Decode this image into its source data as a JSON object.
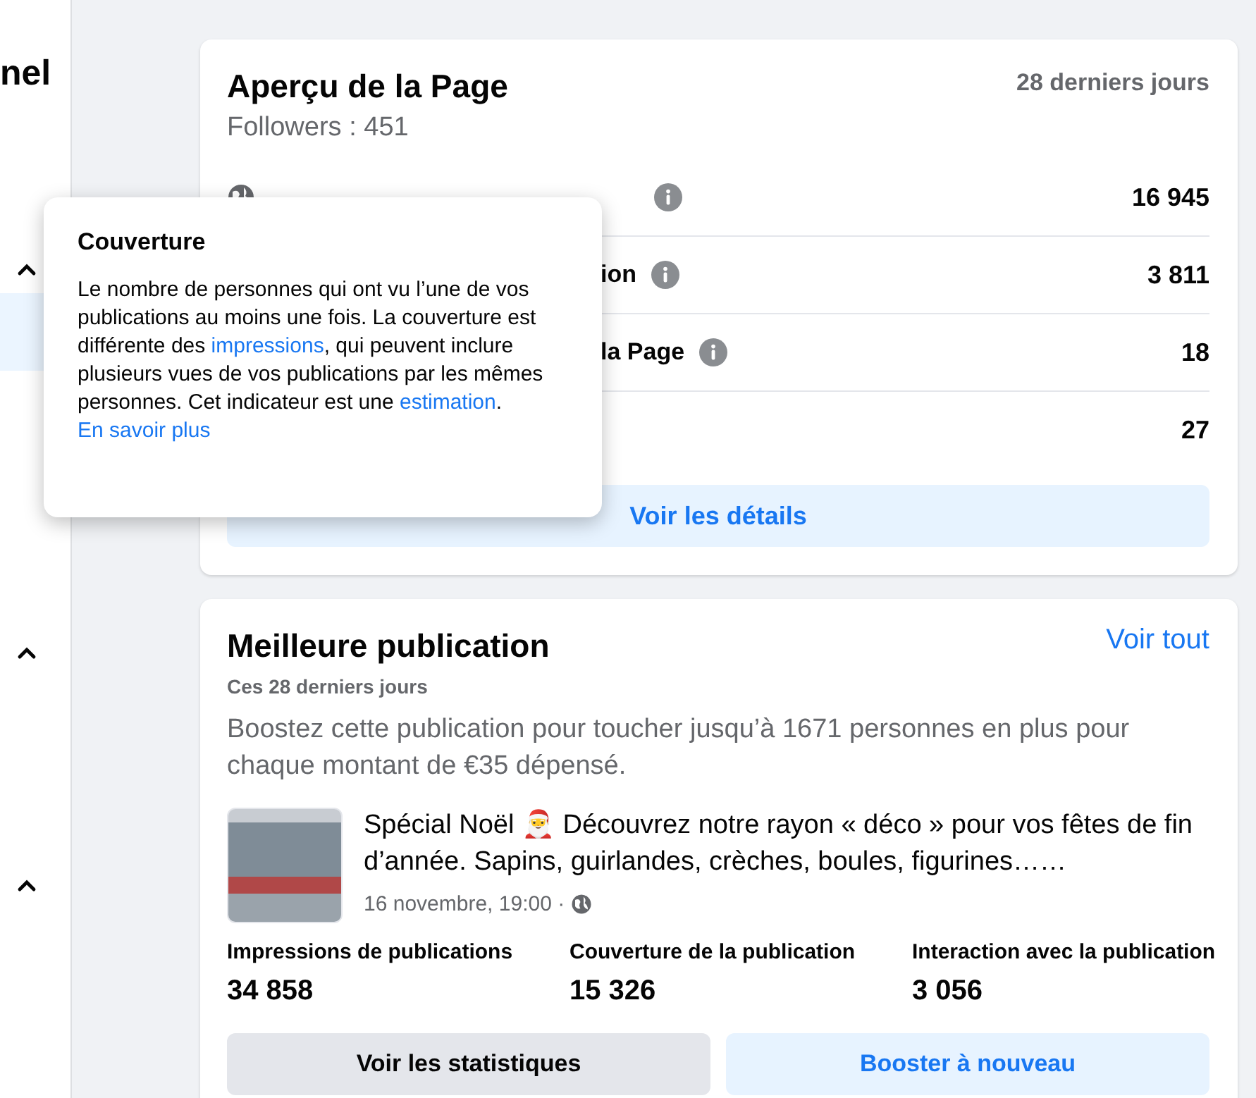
{
  "sidebar": {
    "title": "nel",
    "sections": [
      {
        "expanded": true,
        "items": [
          {
            "selected": true
          }
        ]
      },
      {
        "expanded": true
      },
      {
        "expanded": true
      }
    ]
  },
  "overview": {
    "title": "Aperçu de la Page",
    "period": "28 derniers jours",
    "followers": "Followers : 451",
    "rows": [
      {
        "kind": "covered",
        "info": true,
        "value": "16 945"
      },
      {
        "kind": "partial",
        "label": "ion",
        "info": true,
        "value": "3 811"
      },
      {
        "kind": "partial",
        "label": "la Page",
        "info": true,
        "value": "18"
      },
      {
        "kind": "hidden",
        "info": false,
        "value": "27"
      }
    ],
    "button": "Voir les détails"
  },
  "tooltip": {
    "title": "Couverture",
    "text": "Le nombre de personnes qui ont vu l’une de vos publications au moins une fois. La couverture est différente des ",
    "link1": "impressions",
    "text2": ", qui peuvent inclure plusieurs vues de vos publications par les mêmes personnes. Cet indicateur est une ",
    "link2": "estimation",
    "text3": ". ",
    "link3": "En savoir plus"
  },
  "best_post": {
    "title": "Meilleure publication",
    "see_all": "Voir tout",
    "period": "Ces 28 derniers jours",
    "boost_text": "Boostez cette publication pour toucher jusqu’à 1671 personnes en plus pour chaque montant de €35 dépensé.",
    "post": {
      "text": "Spécial Noël 🎅 Découvrez notre rayon « déco » pour vos fêtes de fin d’année. Sapins, guirlandes, crèches, boules, figurines……",
      "date": "16 novembre, 19:00 ·"
    },
    "stats": [
      {
        "label": "Impressions de publications",
        "value": "34 858"
      },
      {
        "label": "Couverture de la publication",
        "value": "15 326"
      },
      {
        "label": "Interaction avec la publication",
        "value": "3 056"
      }
    ],
    "buttons": [
      {
        "kind": "secondary",
        "label": "Voir les statistiques"
      },
      {
        "kind": "primary",
        "label": "Booster à nouveau"
      }
    ]
  }
}
